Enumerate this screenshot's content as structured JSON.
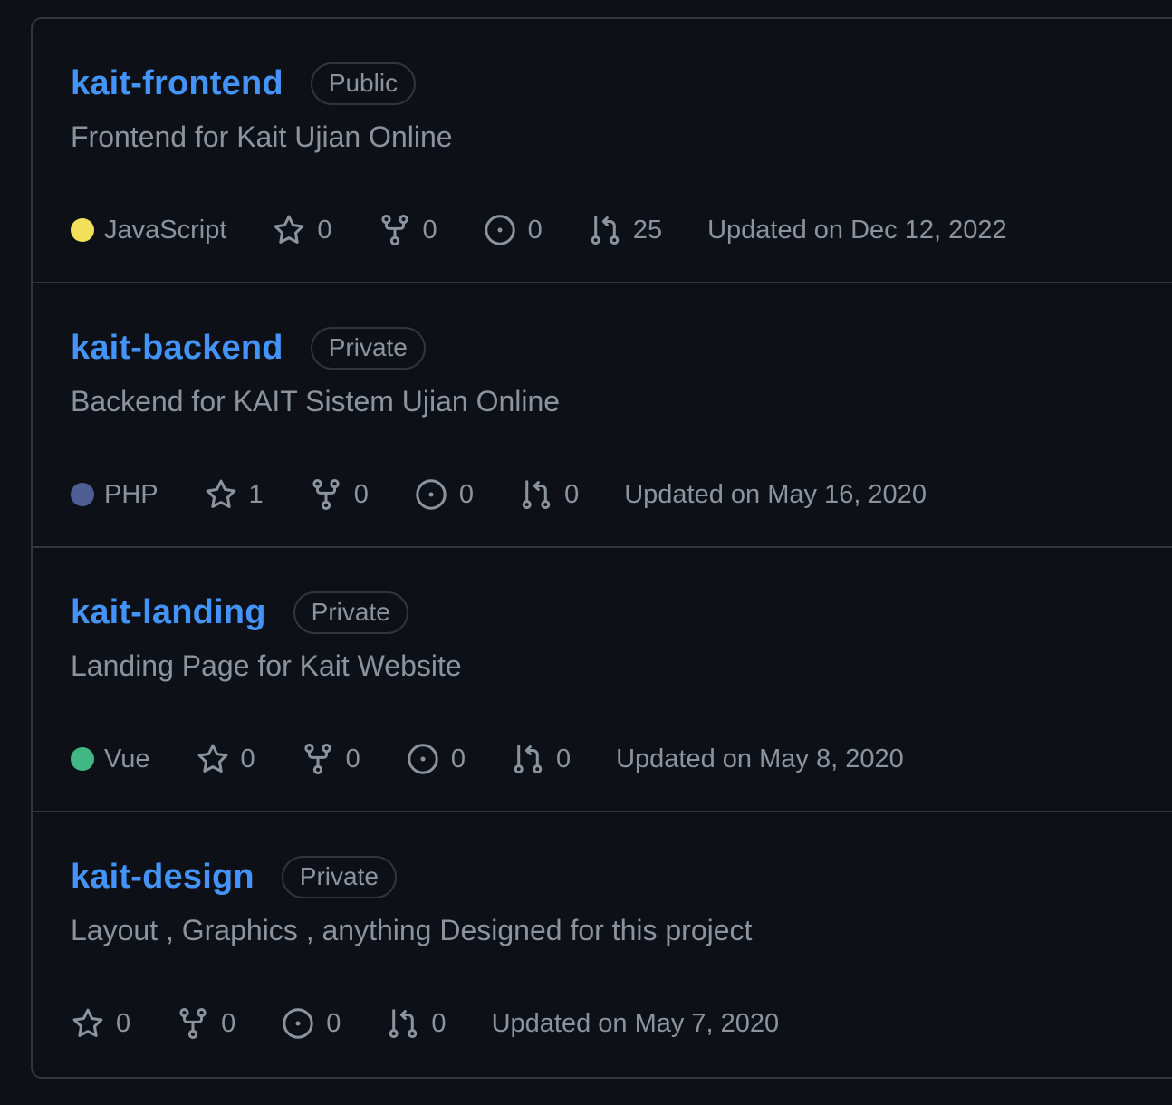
{
  "repos": [
    {
      "name": "kait-frontend",
      "visibility": "Public",
      "description": "Frontend for Kait Ujian Online",
      "language": "JavaScript",
      "language_color": "#f1e05a",
      "stars": "0",
      "forks": "0",
      "issues": "0",
      "pull_requests": "25",
      "updated": "Updated on Dec 12, 2022"
    },
    {
      "name": "kait-backend",
      "visibility": "Private",
      "description": "Backend for KAIT Sistem Ujian Online",
      "language": "PHP",
      "language_color": "#4F5D95",
      "stars": "1",
      "forks": "0",
      "issues": "0",
      "pull_requests": "0",
      "updated": "Updated on May 16, 2020"
    },
    {
      "name": "kait-landing",
      "visibility": "Private",
      "description": "Landing Page for Kait Website",
      "language": "Vue",
      "language_color": "#41b883",
      "stars": "0",
      "forks": "0",
      "issues": "0",
      "pull_requests": "0",
      "updated": "Updated on May 8, 2020"
    },
    {
      "name": "kait-design",
      "visibility": "Private",
      "description": "Layout , Graphics , anything Designed for this project",
      "stars": "0",
      "forks": "0",
      "issues": "0",
      "pull_requests": "0",
      "updated": "Updated on May 7, 2020"
    }
  ],
  "icons": {
    "star": "star-icon",
    "fork": "repo-forked-icon",
    "issue": "issue-opened-icon",
    "pr": "git-pull-request-icon"
  }
}
